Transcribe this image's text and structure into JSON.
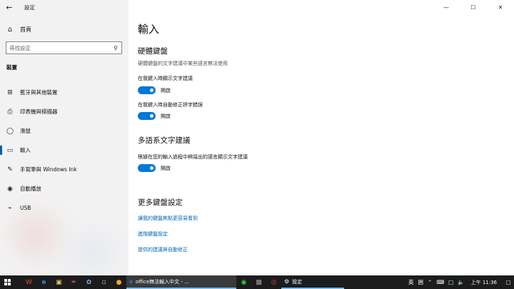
{
  "app": {
    "title": "設定"
  },
  "nav": {
    "back_icon": "back-arrow-icon",
    "home_label": "首頁",
    "search_placeholder": "尋找設定",
    "section_header": "裝置",
    "items": [
      {
        "icon": "bluetooth-devices-icon",
        "glyph": "⊞",
        "label": "藍牙與其他裝置",
        "active": false
      },
      {
        "icon": "printer-icon",
        "glyph": "⎙",
        "label": "印表機與掃描器",
        "active": false
      },
      {
        "icon": "mouse-icon",
        "glyph": "◯",
        "label": "滑鼠",
        "active": false
      },
      {
        "icon": "keyboard-icon",
        "glyph": "▭",
        "label": "輸入",
        "active": true
      },
      {
        "icon": "pen-icon",
        "glyph": "✎",
        "label": "手寫筆與 Windows Ink",
        "active": false
      },
      {
        "icon": "autoplay-icon",
        "glyph": "◉",
        "label": "自動播放",
        "active": false
      },
      {
        "icon": "usb-icon",
        "glyph": "⌁",
        "label": "USB",
        "active": false
      }
    ]
  },
  "window_controls": {
    "minimize": "—",
    "maximize": "☐",
    "close": "✕"
  },
  "main": {
    "title": "輸入",
    "hardware_keyboard": {
      "heading": "硬體鍵盤",
      "description": "硬體鍵盤的文字建議中某些語言無法使用",
      "opt1_label": "在我鍵入時顯示文字建議",
      "opt1_state": "開啟",
      "opt2_label": "在我鍵入時自動修正拼字錯誤",
      "opt2_state": "開啟"
    },
    "multilingual": {
      "heading": "多語系文字建議",
      "opt_label": "根據在您的輸入過程中辨識出的語言顯示文字建議",
      "opt_state": "開啟"
    },
    "more_keyboard": {
      "heading": "更多鍵盤設定",
      "link1": "讓我的鍵盤焦點更容易看到",
      "link2": "進階鍵盤設定",
      "link3": "提供的建議與自動修正"
    }
  },
  "toggles": {
    "on_color": "#0078d7"
  },
  "taskbar": {
    "task1_label": "office無法輸入中文 - ...",
    "task2_label": "設定",
    "tray_ime": "英",
    "tray_extra": "囲",
    "clock": "上午 11:36"
  }
}
